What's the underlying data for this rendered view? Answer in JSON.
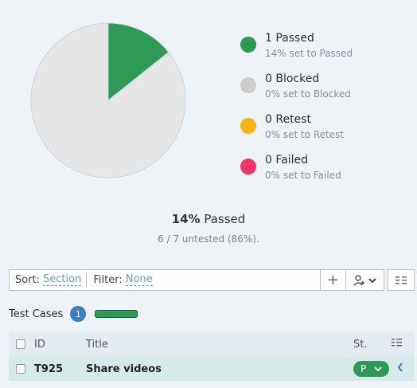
{
  "chart_data": {
    "type": "pie",
    "slices": [
      {
        "label": "Passed",
        "value": 1,
        "color": "#2e9a55"
      },
      {
        "label": "Untested",
        "value": 6,
        "color": "#e6e6e6"
      }
    ]
  },
  "legend": [
    {
      "title": "1 Passed",
      "sub": "14% set to Passed",
      "color": "#2e9a55"
    },
    {
      "title": "0 Blocked",
      "sub": "0% set to Blocked",
      "color": "#cccccc"
    },
    {
      "title": "0 Retest",
      "sub": "0% set to Retest",
      "color": "#fbb414"
    },
    {
      "title": "0 Failed",
      "sub": "0% set to Failed",
      "color": "#ee3566"
    }
  ],
  "summary": {
    "pct": "14%",
    "passed_label": "Passed",
    "untested": "6 / 7 untested (86%)."
  },
  "toolbar": {
    "sort_label": "Sort:",
    "sort_value": "Section",
    "filter_label": "Filter:",
    "filter_value": "None",
    "add_icon": "+"
  },
  "test_cases": {
    "title": "Test Cases",
    "count": "1",
    "progress_passed_fraction": 1.0
  },
  "table": {
    "headers": {
      "id": "ID",
      "title": "Title",
      "status": "St."
    },
    "rows": [
      {
        "id": "T925",
        "title": "Share videos",
        "status": "P"
      }
    ]
  }
}
